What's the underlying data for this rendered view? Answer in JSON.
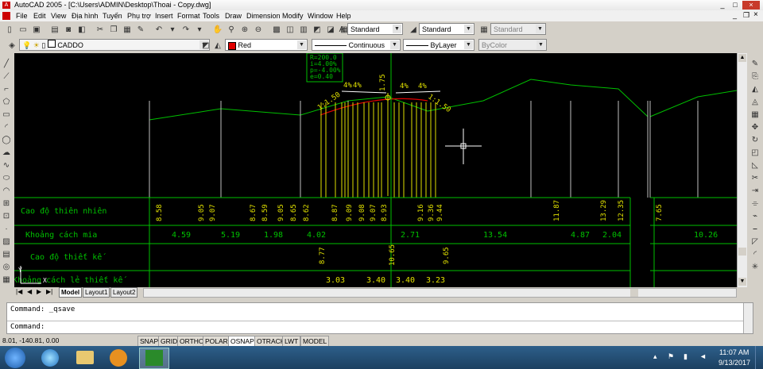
{
  "window": {
    "title": "AutoCAD 2005 - [C:\\Users\\ADMIN\\Desktop\\Thoai - Copy.dwg]",
    "min": "_",
    "max": "□",
    "close": "×"
  },
  "menu": [
    "File",
    "Edit",
    "View",
    "Địa hình",
    "Tuyến",
    "Phụ trợ",
    "Insert",
    "Format",
    "Tools",
    "Draw",
    "Dimension",
    "Modify",
    "Window",
    "Help"
  ],
  "toolbar": {
    "text_style": "Standard",
    "dim_style": "Standard",
    "table_style": "Standard",
    "layer": "CADDO",
    "color": "Red",
    "linetype": "Continuous",
    "lineweight": "ByLayer",
    "plotstyle": "ByColor",
    "color_swatch": "#e00000"
  },
  "drawing": {
    "curve": [
      "R=200.0",
      "i=4.00%",
      "p=-4.00%",
      "e=0.40"
    ],
    "slope_left": "1:1.50",
    "slope_right": "1:1.50",
    "center": "1.75",
    "pct_labels": [
      "4%",
      "4%",
      "4%",
      "4%"
    ],
    "rows": [
      "Cao độ thiên nhiên",
      "Khoảng cách mia",
      "Cao độ thiết kế",
      "Khoảng cách lẻ thiết kế"
    ],
    "natural_levels": [
      "8.58",
      "9.05",
      "9.07",
      "8.67",
      "8.59",
      "9.05",
      "8.65",
      "8.62",
      "8.87",
      "9.09",
      "9.08",
      "9.07",
      "8.93",
      "9.16",
      "9.36",
      "9.44",
      "11.87",
      "13.29",
      "12.35",
      "7.65"
    ],
    "distances": [
      "4.59",
      "5.19",
      "1.98",
      "4.02",
      "2.71",
      "13.54",
      "4.87",
      "2.04",
      "10.26"
    ],
    "design_levels": [
      "8.77",
      "10.65",
      "9.65"
    ],
    "design_distances": [
      "3.03",
      "3.40",
      "3.40",
      "3.23"
    ],
    "axis_y": "Y",
    "axis_x": "X"
  },
  "tabs": [
    "Model",
    "Layout1",
    "Layout2"
  ],
  "command": {
    "line1": "Command: _qsave",
    "line2": "Command:"
  },
  "status": {
    "coords": "8.01, -140.81, 0.00",
    "toggles": [
      "SNAP",
      "GRID",
      "ORTHO",
      "POLAR",
      "OSNAP",
      "OTRACK",
      "LWT",
      "MODEL"
    ]
  },
  "tray": {
    "time": "11:07 AM",
    "date": "9/13/2017"
  }
}
